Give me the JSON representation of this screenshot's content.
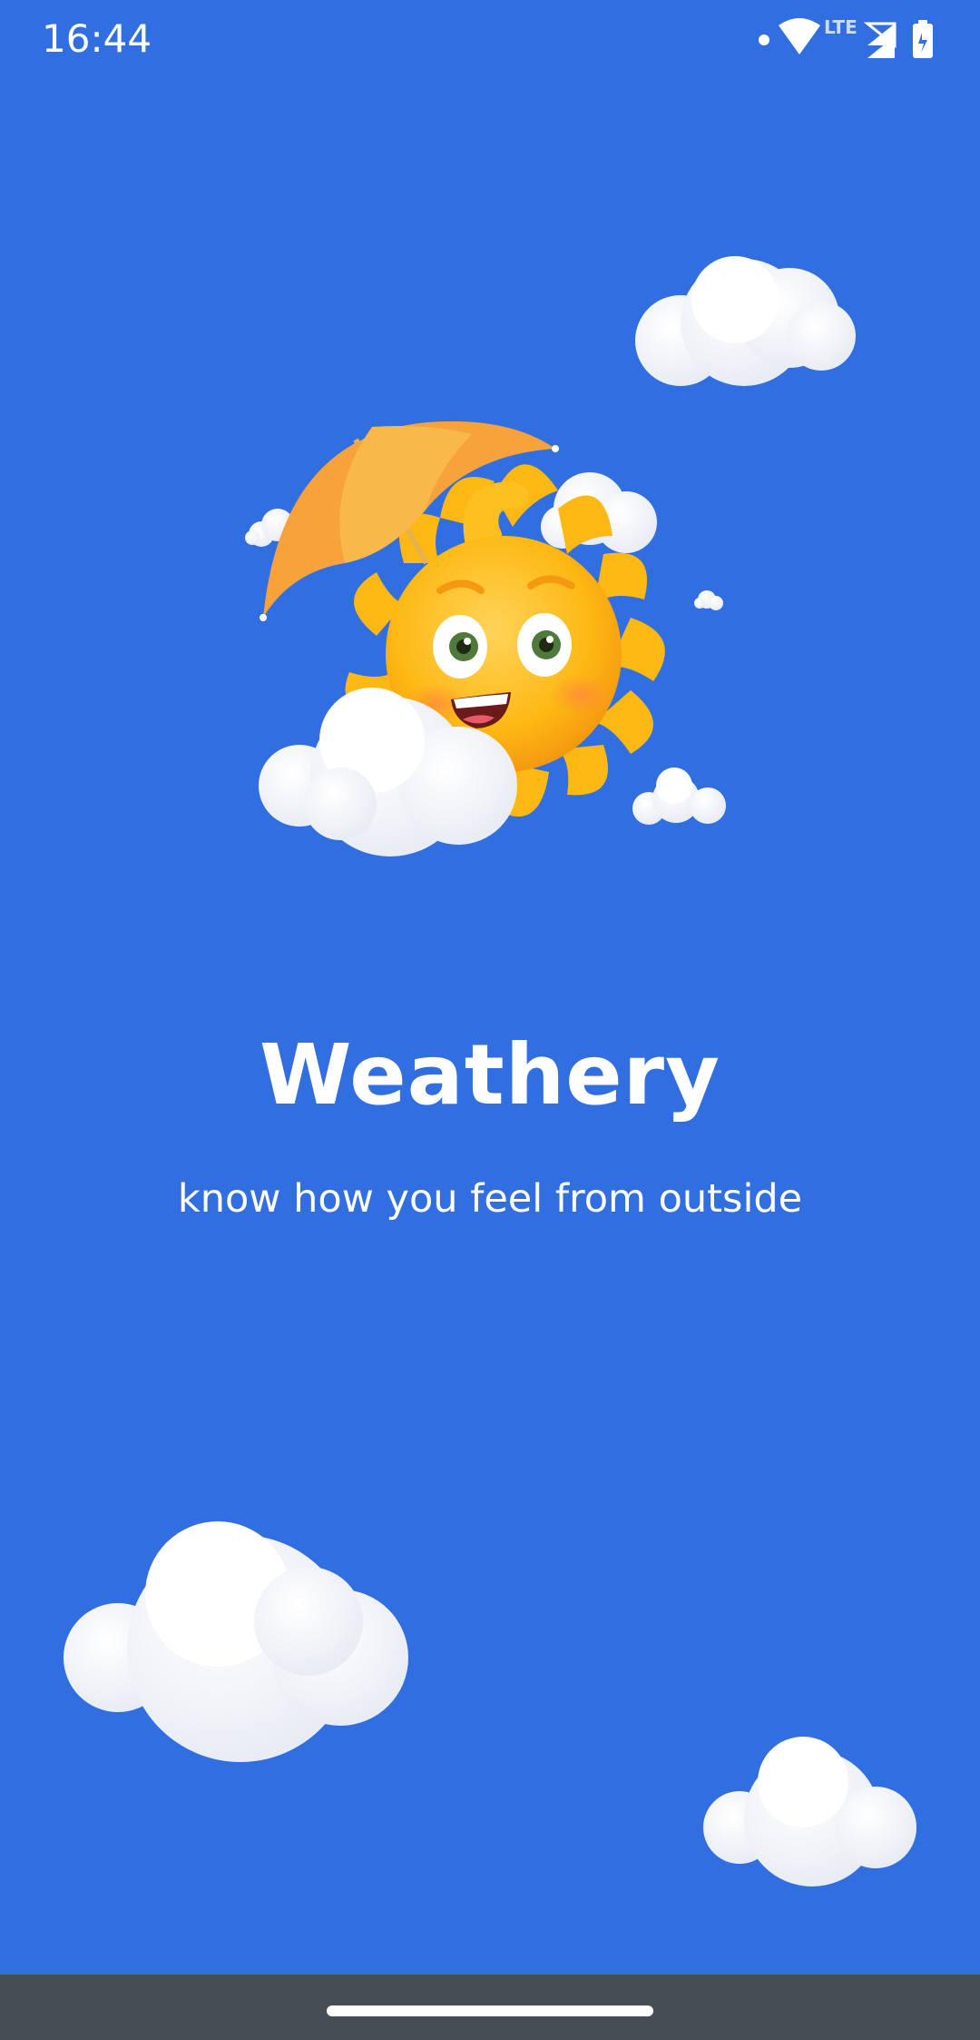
{
  "status_bar": {
    "time": "16:44",
    "network_label": "LTE",
    "icons": [
      "notification-dot-icon",
      "wifi-icon",
      "cell-signal-icon",
      "cell-signal-icon",
      "battery-icon"
    ]
  },
  "splash": {
    "title": "Weathery",
    "tagline": "know how you feel from outside",
    "mascot": "sun-with-umbrella-illustration",
    "decorations": [
      "cloud-icon",
      "cloud-icon",
      "cloud-icon",
      "cloud-icon",
      "cloud-icon",
      "cloud-icon"
    ]
  },
  "colors": {
    "background": "#316fe0",
    "text": "#ffffff",
    "nav_bar": "#474d54",
    "sun": "#fdb813",
    "umbrella": "#f7a23a",
    "cloud": "#f5f7fb"
  }
}
